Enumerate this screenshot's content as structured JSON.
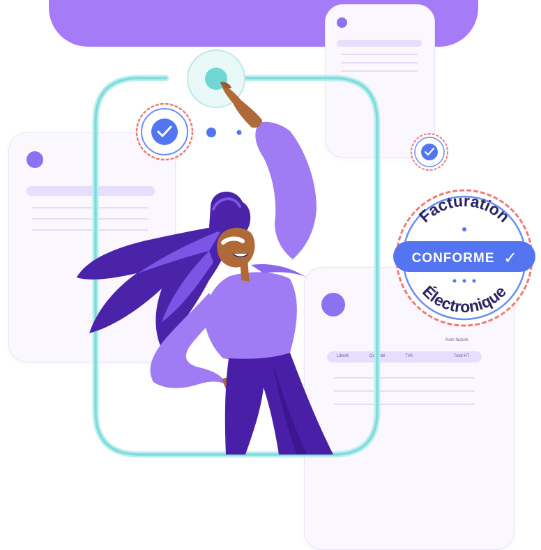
{
  "badge": {
    "top_text": "Facturation",
    "banner_text": "CONFORME",
    "bottom_text": "Électronique",
    "check_glyph": "✓"
  },
  "invoice": {
    "number_label": "Num facture",
    "columns": [
      "Libellé",
      "Quantité",
      "TVA",
      "Total HT"
    ]
  },
  "colors": {
    "purple": "#a57bf7",
    "frame": "#7edcdc",
    "badge_blue": "#5475f2",
    "badge_ring": "#ef7b76",
    "card_bg": "#faf7ff"
  },
  "icons": [
    "check-icon",
    "avatar-icon",
    "verified-seal-icon"
  ]
}
